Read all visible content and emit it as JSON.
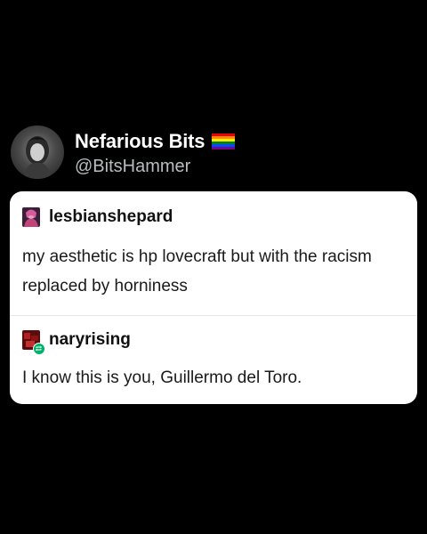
{
  "tweet": {
    "display_name": "Nefarious Bits",
    "handle": "@BitsHammer",
    "flag_icon": "rainbow-flag-icon",
    "avatar_icon": "profile-avatar"
  },
  "screenshot_card": {
    "posts": [
      {
        "username": "lesbianshepard",
        "text": "my aesthetic is hp lovecraft but with the racism replaced by horniness",
        "avatar_color": "#c2457a"
      },
      {
        "username": "naryrising",
        "text": "I know this is you, Guillermo del Toro.",
        "avatar_color": "#9a1a1a",
        "badge_icon": "reblog-icon",
        "badge_color": "#00b06b"
      }
    ]
  },
  "colors": {
    "background": "#000000",
    "name": "#ffffff",
    "handle": "#b9bcc0",
    "card": "#ffffff"
  }
}
